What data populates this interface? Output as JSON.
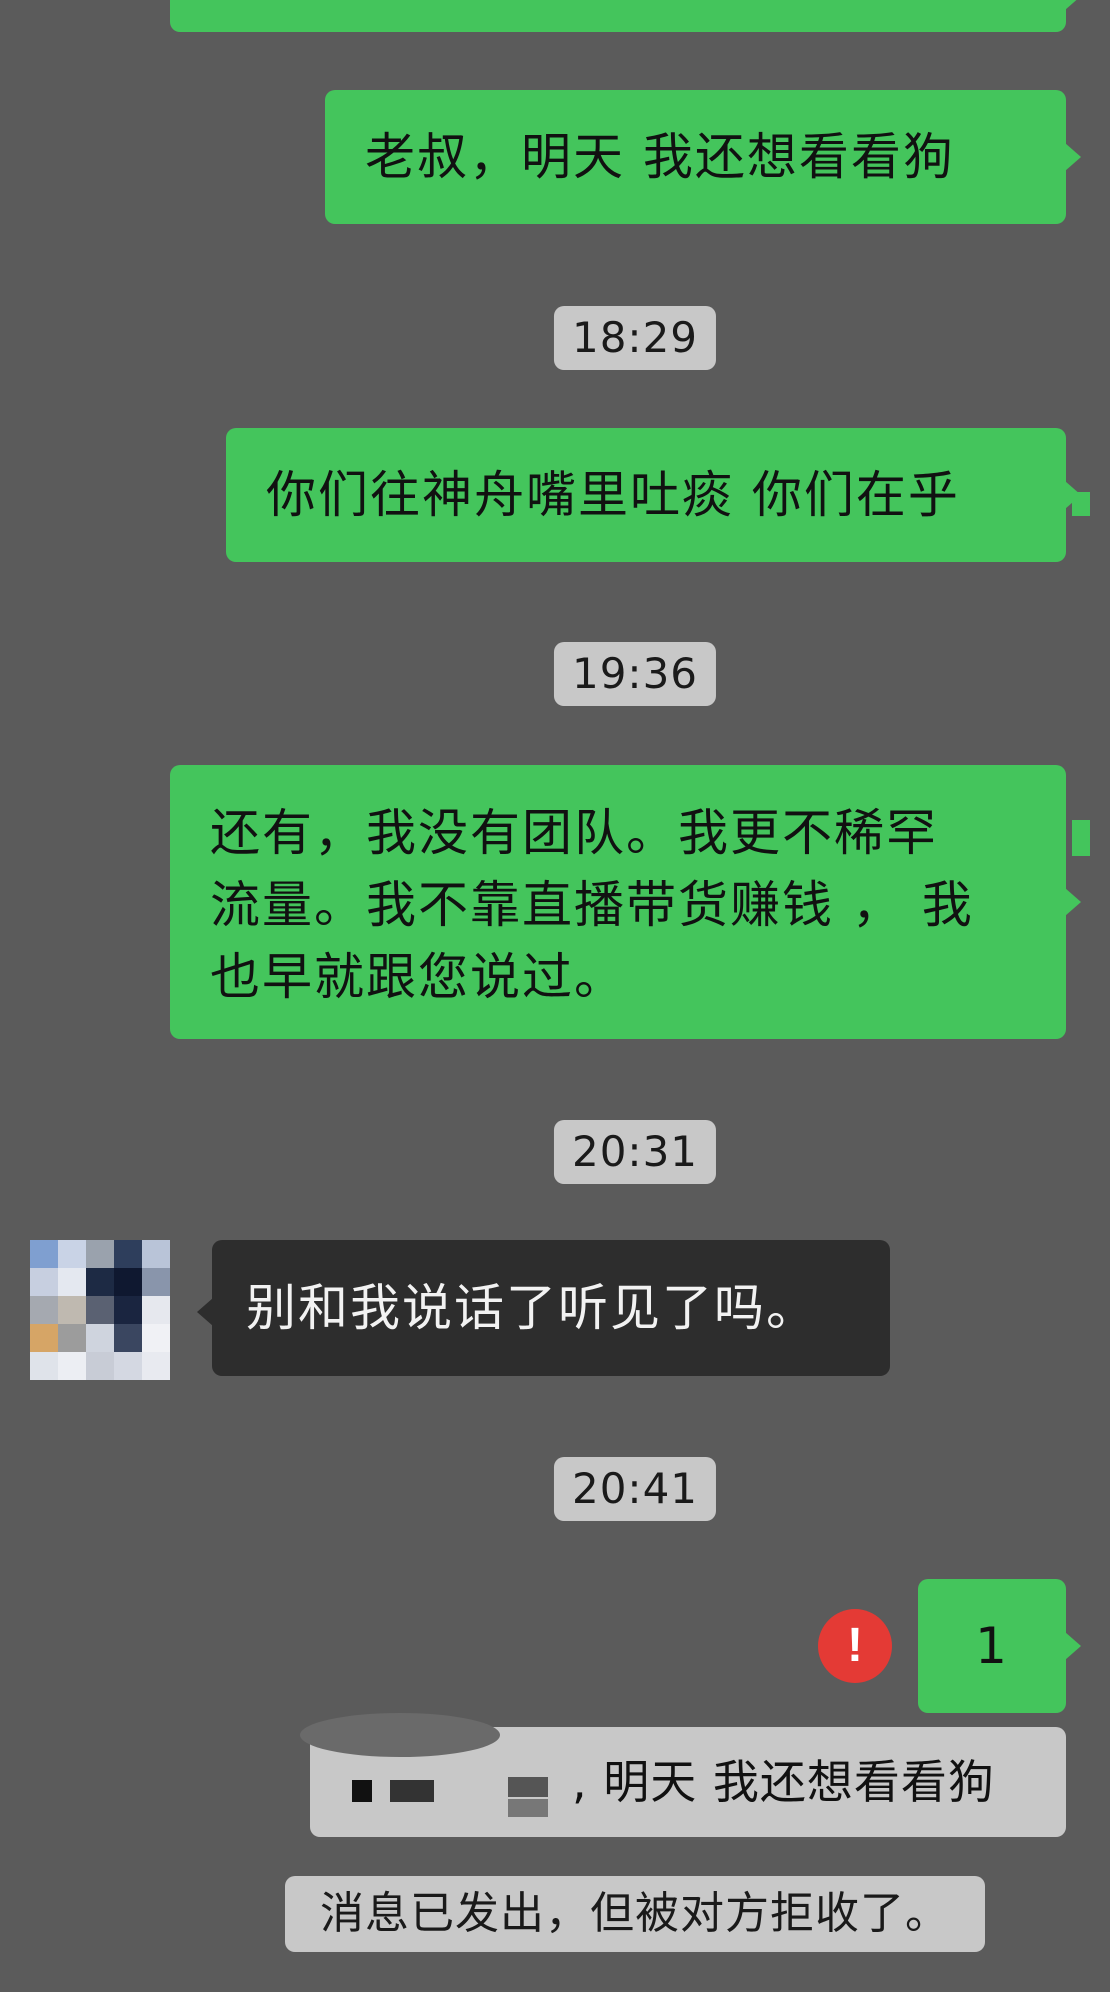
{
  "messages": {
    "m1": "老叔，明天 我还想看看狗",
    "m2": "你们往神舟嘴里吐痰 你们在乎",
    "m3_line1": "还有，我没有团队。我更不稀罕",
    "m3_line2": "流量。我不靠直播带货赚钱 ， 我",
    "m3_line3": "也早就跟您说过。",
    "incoming": "别和我说话了听见了吗。",
    "m4": "1"
  },
  "times": {
    "t1": "18:29",
    "t2": "19:36",
    "t3": "20:31",
    "t4": "20:41"
  },
  "error_badge": "!",
  "quote": {
    "text": ", 明天 我还想看看狗"
  },
  "system": {
    "rejected": "消息已发出，但被对方拒收了。"
  },
  "colors": {
    "background": "#5b5b5b",
    "outgoing_bubble": "#44c55c",
    "incoming_bubble": "#2d2d2d",
    "timestamp_bg": "#c8c8c8",
    "error": "#e43a35"
  }
}
